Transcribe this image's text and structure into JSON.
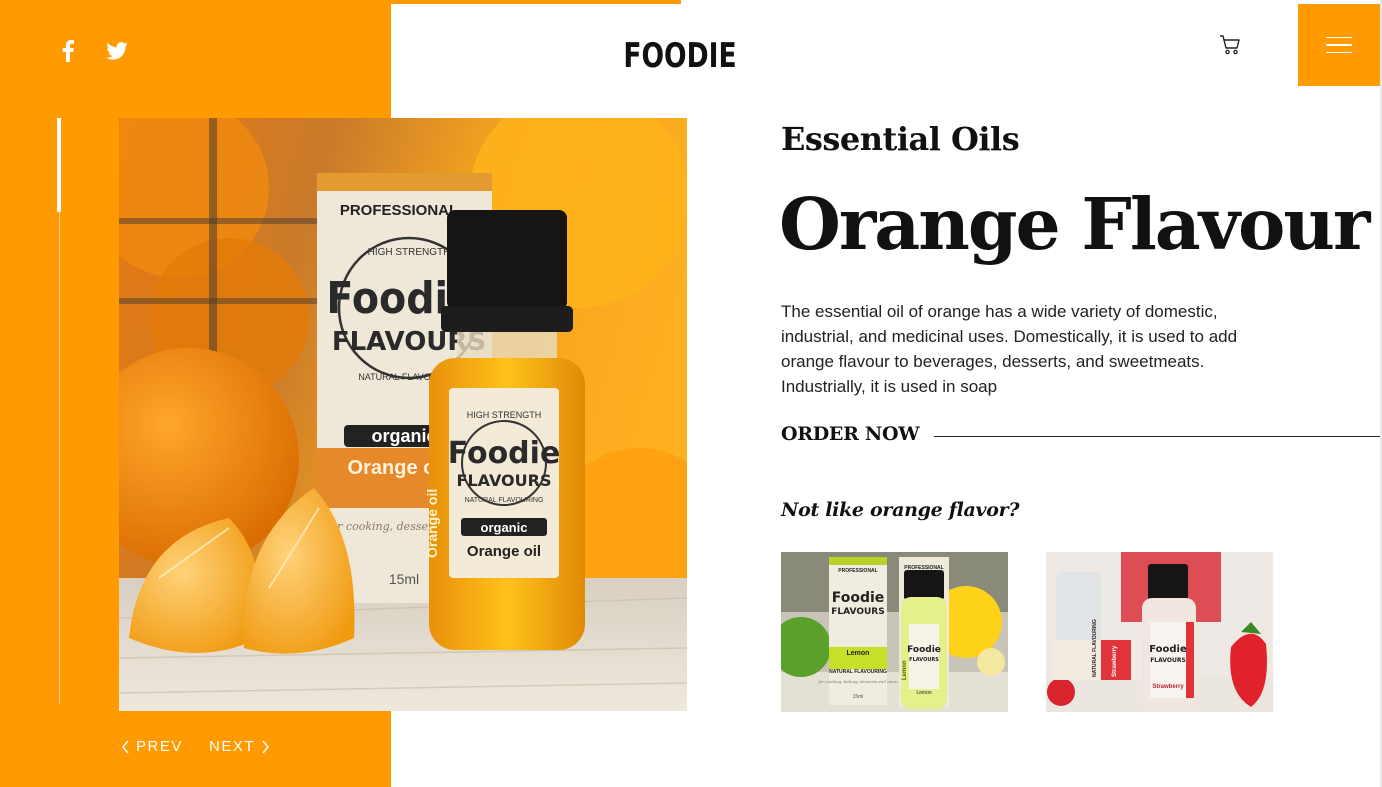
{
  "brand": {
    "name": "FOODIE"
  },
  "social": {
    "facebook": "facebook-icon",
    "twitter": "twitter-icon"
  },
  "header": {
    "cart_icon": "shopping-cart-icon",
    "menu_icon": "hamburger-menu-icon"
  },
  "colors": {
    "accent": "#ff9a00",
    "text": "#111111",
    "background": "#ffffff"
  },
  "hero": {
    "box_text": [
      "PROFESSIONAL",
      "HIGH STRENGTH",
      "Foodie",
      "FLAVOURS",
      "NATURAL FLAVOURING",
      "organic",
      "Orange oil",
      "for cooking, desserts and",
      "15ml"
    ],
    "bottle_text": [
      "HIGH STRENGTH",
      "Foodie",
      "FLAVOURS",
      "NATURAL FLAVOURING",
      "organic",
      "Orange oil",
      "Orange oil"
    ]
  },
  "slider": {
    "position": 0.16
  },
  "pager": {
    "prev_label": "PREV",
    "next_label": "NEXT"
  },
  "product": {
    "category": "Essential Oils",
    "title": "Orange Flavour",
    "description": "The essential oil of orange has a wide variety of domestic, industrial, and medicinal uses. Domestically, it is used to add orange flavour to beverages, desserts, and sweetmeats. Industrially, it is used in soap",
    "order_label": "ORDER NOW"
  },
  "alternatives": {
    "heading": "Not like orange flavor?",
    "items": [
      {
        "box_text": [
          "PROFESSIONAL",
          "Foodie",
          "FLAVOURS",
          "Lemon",
          "NATURAL FLAVOURING",
          "for cooking, baking, desserts and more",
          "15ml"
        ],
        "bottle_text": [
          "PROFESSIONAL",
          "Foodie",
          "FLAVOURS",
          "Lemon",
          "Lemon"
        ]
      },
      {
        "box_text": [
          "NATURAL FLAVOURING",
          "Strawberry"
        ],
        "bottle_text": [
          "Foodie",
          "FLAVOURS",
          "Strawberry"
        ]
      }
    ]
  }
}
